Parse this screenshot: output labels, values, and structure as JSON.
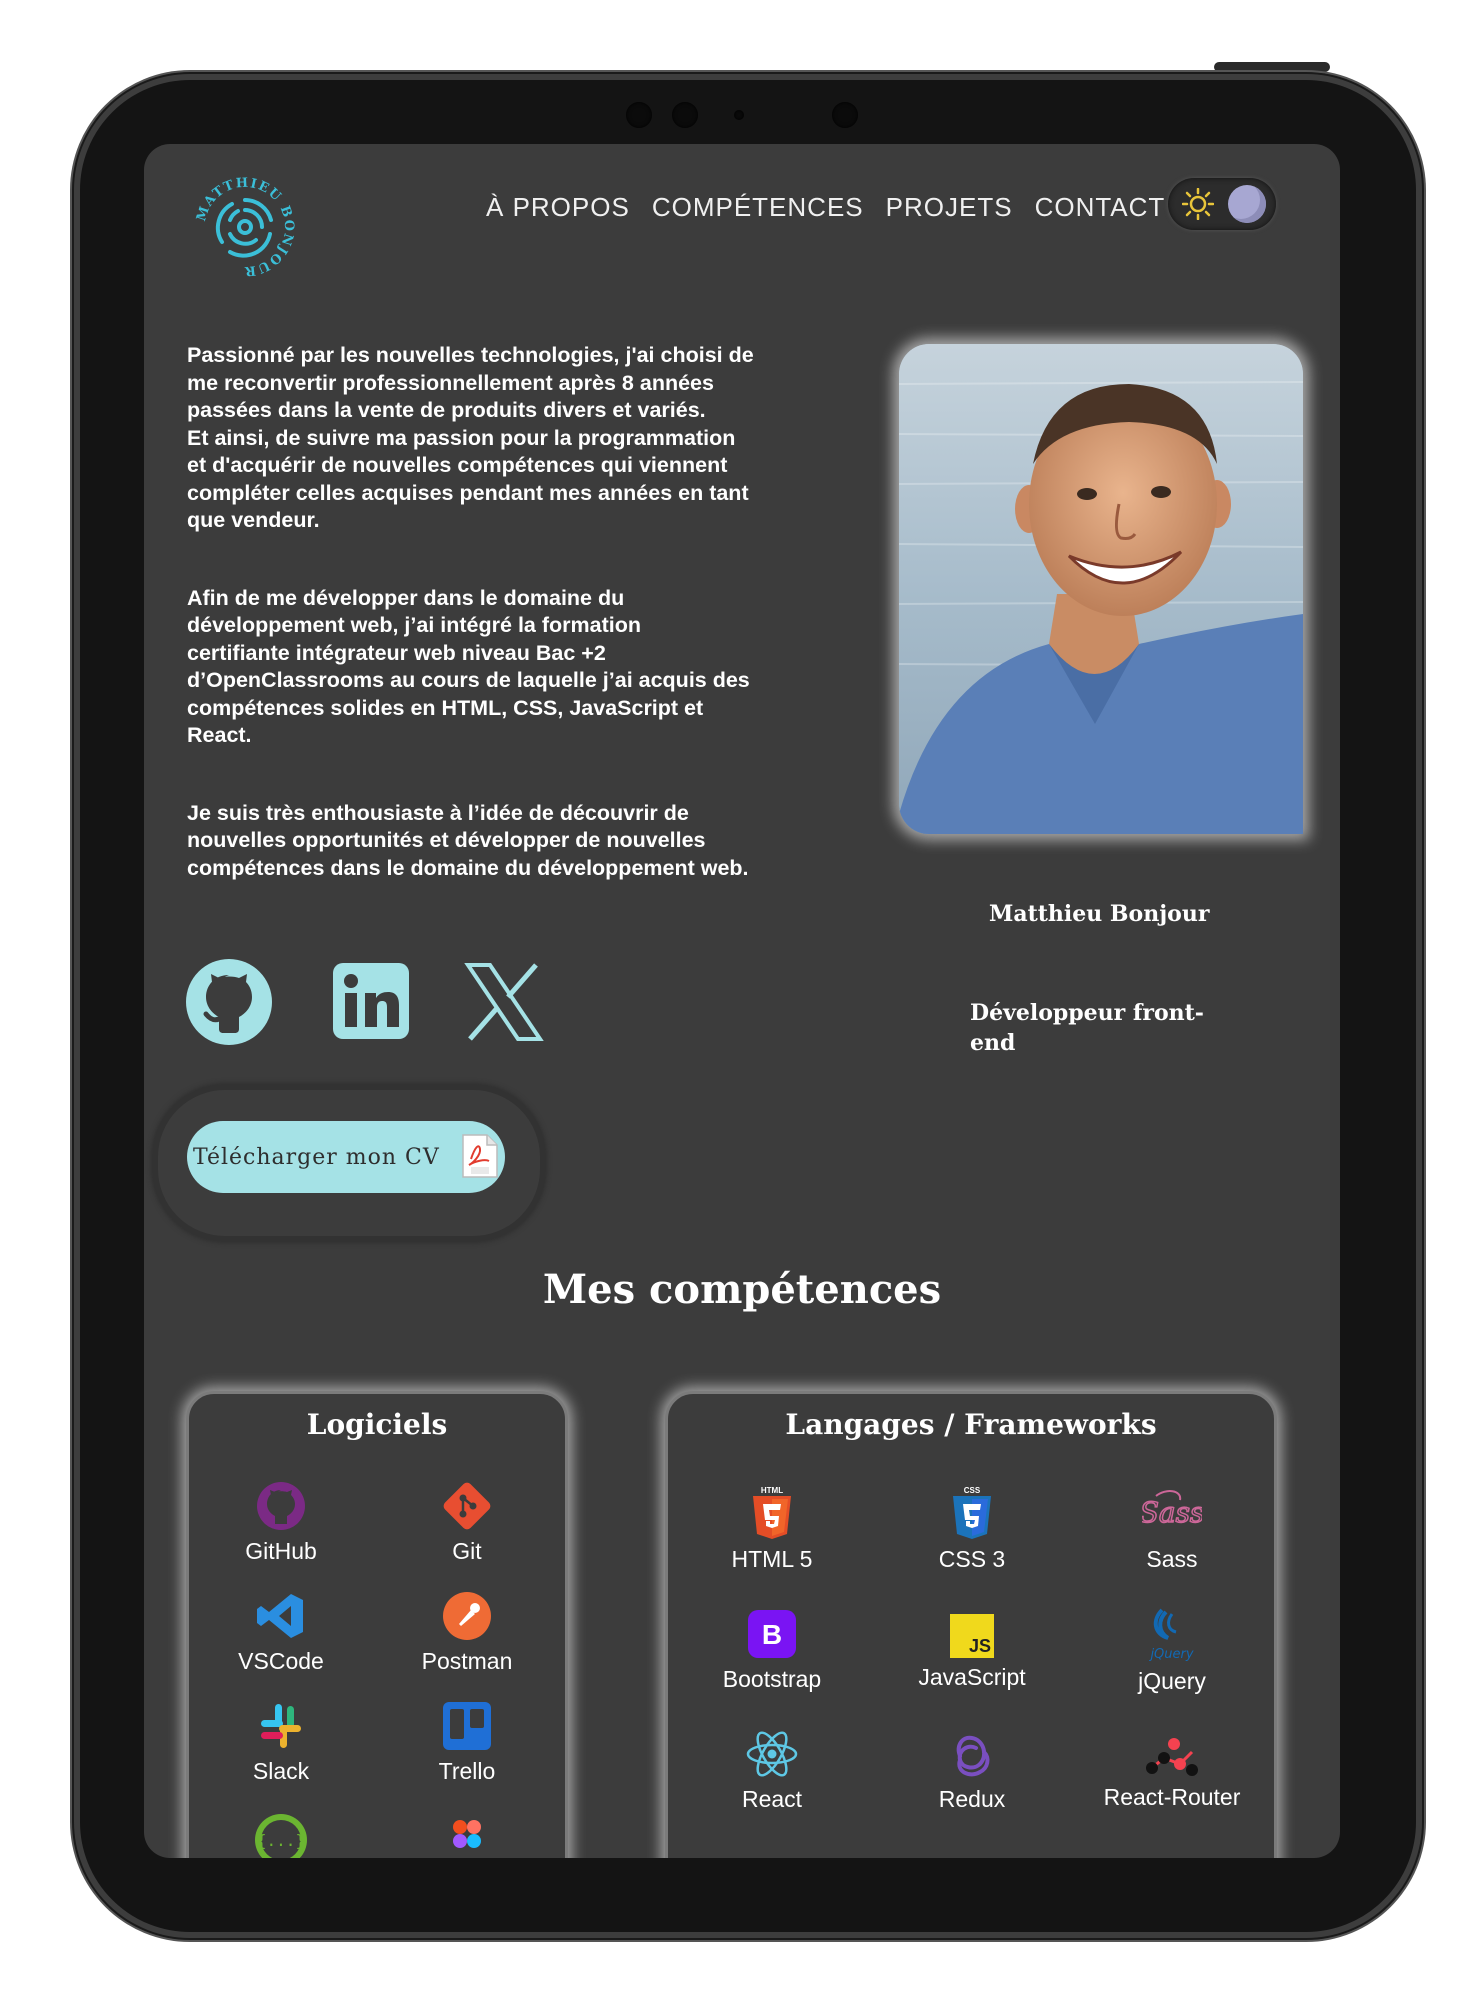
{
  "header": {
    "logo_text": "MATTHIEU BONJOUR",
    "nav": [
      "À PROPOS",
      "COMPÉTENCES",
      "PROJETS",
      "CONTACT"
    ],
    "theme_toggle": {
      "icons": [
        "sun-icon",
        "moon-icon"
      ],
      "state": "dark"
    }
  },
  "intro": {
    "paragraphs": [
      "Passionné par les nouvelles technologies, j'ai choisi de\nme reconvertir professionnellement après 8 années\npassées dans la vente de produits divers et variés.\nEt ainsi, de suivre ma passion pour la programmation\net d'acquérir de nouvelles compétences qui viennent\ncompléter celles acquises pendant mes années en tant\nque vendeur.",
      "Afin de me développer dans le domaine du\ndéveloppement web, j’ai intégré la formation\ncertifiante intégrateur web niveau Bac +2\nd’OpenClassrooms au cours de laquelle j’ai acquis des\ncompétences solides en HTML, CSS, JavaScript et\nReact.",
      "Je suis très enthousiaste à l’idée de découvrir de\nnouvelles opportunités et développer de nouvelles\ncompétences dans le domaine du développement web."
    ]
  },
  "profile": {
    "name": "Matthieu Bonjour",
    "role": "Développeur front-end"
  },
  "socials": [
    "github-icon",
    "linkedin-icon",
    "x-icon"
  ],
  "cv_button": {
    "label": "Télécharger mon CV",
    "icon": "pdf-icon"
  },
  "skills": {
    "title": "Mes compétences",
    "software": {
      "title": "Logiciels",
      "items": [
        "GitHub",
        "Git",
        "VSCode",
        "Postman",
        "Slack",
        "Trello"
      ]
    },
    "languages": {
      "title": "Langages / Frameworks",
      "items": [
        "HTML 5",
        "CSS 3",
        "Sass",
        "Bootstrap",
        "JavaScript",
        "jQuery",
        "React",
        "Redux",
        "React-Router"
      ]
    }
  },
  "colors": {
    "background": "#3c3c3c",
    "accent": "#a5e2e6",
    "logo": "#3bbfd8"
  }
}
